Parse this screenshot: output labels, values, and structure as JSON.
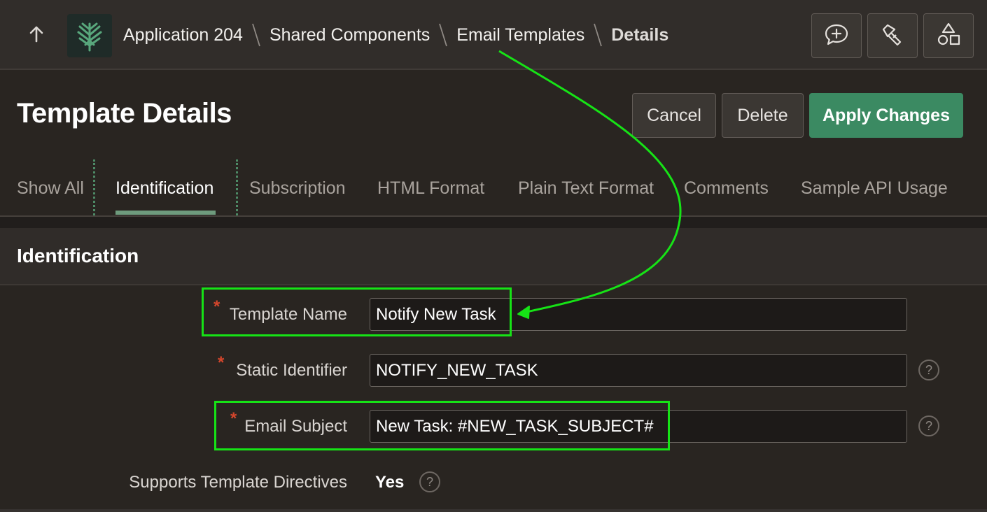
{
  "topbar": {
    "up_icon": "arrow-up-icon",
    "logo_icon": "tree-logo-icon",
    "breadcrumb": [
      {
        "label": "Application 204"
      },
      {
        "label": "Shared Components"
      },
      {
        "label": "Email Templates"
      },
      {
        "label": "Details"
      }
    ],
    "tools": [
      {
        "icon": "comment-add-icon"
      },
      {
        "icon": "flashlight-icon"
      },
      {
        "icon": "shapes-icon"
      }
    ]
  },
  "page": {
    "title": "Template Details",
    "buttons": {
      "cancel": "Cancel",
      "delete": "Delete",
      "apply": "Apply Changes"
    }
  },
  "tabs": [
    {
      "label": "Show All",
      "active": false
    },
    {
      "label": "Identification",
      "active": true
    },
    {
      "label": "Subscription",
      "active": false
    },
    {
      "label": "HTML Format",
      "active": false
    },
    {
      "label": "Plain Text Format",
      "active": false
    },
    {
      "label": "Comments",
      "active": false
    },
    {
      "label": "Sample API Usage",
      "active": false
    }
  ],
  "section": {
    "title": "Identification",
    "fields": {
      "template_name": {
        "label": "Template Name",
        "value": "Notify New Task",
        "required": "*"
      },
      "static_identifier": {
        "label": "Static Identifier",
        "value": "NOTIFY_NEW_TASK",
        "required": "*"
      },
      "email_subject": {
        "label": "Email Subject",
        "value": "New Task: #NEW_TASK_SUBJECT#",
        "required": "*"
      },
      "supports_directives": {
        "label": "Supports Template Directives",
        "value": "Yes"
      }
    },
    "help_icon": "help-icon",
    "help_glyph": "?"
  },
  "colors": {
    "background": "#292521",
    "topbar": "#312d2a",
    "primary_button": "#3b8a62",
    "active_tab_underline": "#6e9b7d",
    "required_marker": "#d4462c",
    "annotation": "#16e316"
  }
}
